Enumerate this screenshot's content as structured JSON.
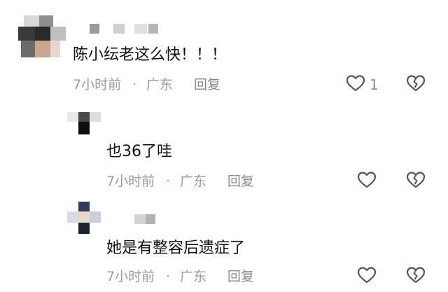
{
  "comments": [
    {
      "text": "陈小纭老这么快！！！",
      "time": "7小时前",
      "location": "广东",
      "reply_label": "回复",
      "like_count": "1"
    },
    {
      "text": "也36了哇",
      "time": "7小时前",
      "location": "广东",
      "reply_label": "回复",
      "like_count": ""
    },
    {
      "text": "她是有整容后遗症了",
      "time": "7小时前",
      "location": "广东",
      "reply_label": "回复",
      "like_count": ""
    }
  ],
  "separator": "·",
  "icons": {
    "like": "heart-outline-icon",
    "dislike": "broken-heart-icon"
  },
  "colors": {
    "text": "#111111",
    "meta": "#9a9a9a",
    "icon": "#555555"
  }
}
